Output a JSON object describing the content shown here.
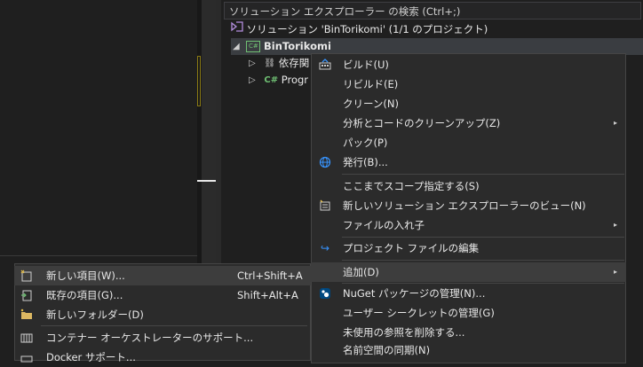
{
  "solution_explorer": {
    "search_placeholder": "ソリューション エクスプローラー の検索 (Ctrl+;)",
    "tree": {
      "solution_label": "ソリューション 'BinTorikomi' (1/1 のプロジェクト)",
      "project_label": "BinTorikomi",
      "deps_label": "依存関",
      "program_label": "Progr"
    }
  },
  "context_menu": {
    "items": [
      {
        "label": "ビルド(U)",
        "icon": "build-icon"
      },
      {
        "label": "リビルド(E)"
      },
      {
        "label": "クリーン(N)"
      },
      {
        "label": "分析とコードのクリーンアップ(Z)",
        "submenu": true
      },
      {
        "label": "パック(P)"
      },
      {
        "label": "発行(B)...",
        "icon": "globe-icon"
      },
      {
        "label": "ここまでスコープ指定する(S)"
      },
      {
        "label": "新しいソリューション エクスプローラーのビュー(N)",
        "icon": "new-view-icon"
      },
      {
        "label": "ファイルの入れ子",
        "submenu": true
      },
      {
        "label": "プロジェクト ファイルの編集",
        "icon": "redo-arrow-icon"
      },
      {
        "label": "追加(D)",
        "submenu": true,
        "highlighted": true
      },
      {
        "label": "NuGet パッケージの管理(N)...",
        "icon": "nuget-icon"
      },
      {
        "label": "ユーザー シークレットの管理(G)"
      },
      {
        "label": "未使用の参照を削除する..."
      },
      {
        "label": "名前空間の同期(N)"
      }
    ],
    "arrow_glyph": "▸"
  },
  "add_submenu": {
    "items": [
      {
        "label": "新しい項目(W)...",
        "shortcut": "Ctrl+Shift+A",
        "icon": "new-item-icon",
        "highlighted": true
      },
      {
        "label": "既存の項目(G)...",
        "shortcut": "Shift+Alt+A",
        "icon": "existing-item-icon"
      },
      {
        "label": "新しいフォルダー(D)",
        "shortcut": "",
        "icon": "new-folder-icon"
      },
      {
        "label": "コンテナー オーケストレーターのサポート...",
        "shortcut": "",
        "icon": "container-icon"
      },
      {
        "label": "Docker サポート...",
        "shortcut": "",
        "icon": "docker-icon"
      }
    ]
  },
  "colors": {
    "background": "#1f1f1f",
    "menu_bg": "#2b2b2b",
    "highlight": "#3d3d3d",
    "accent_green": "#6fbf73",
    "accent_blue": "#3794ff"
  }
}
